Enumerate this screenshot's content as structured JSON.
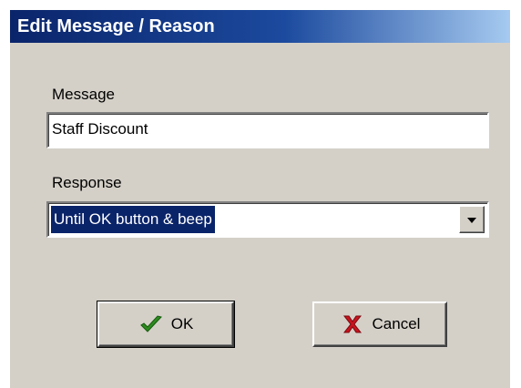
{
  "dialog": {
    "title": "Edit Message / Reason"
  },
  "message": {
    "label": "Message",
    "value": "Staff Discount"
  },
  "response": {
    "label": "Response",
    "selected": "Until OK button & beep"
  },
  "buttons": {
    "ok_label": "OK",
    "cancel_label": "Cancel"
  },
  "icons": {
    "ok": "checkmark-icon",
    "cancel": "x-icon",
    "dropdown": "chevron-down-icon"
  },
  "colors": {
    "title_start": "#0a246a",
    "title_end": "#a6caf0",
    "dialog_bg": "#d4d0c8",
    "selection": "#0a246a",
    "check_green": "#2e8b1f",
    "cancel_red": "#c8141e"
  }
}
